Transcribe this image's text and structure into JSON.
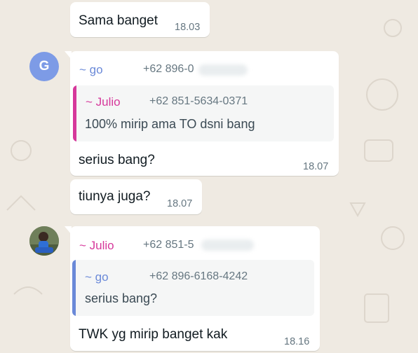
{
  "colors": {
    "background": "#efeae2",
    "bubble": "#ffffff",
    "go_name": "#6a89d8",
    "julio_name": "#d6389b",
    "go_avatar": "#7d9be6",
    "julio_bar": "#d6389b",
    "go_bar": "#6a89d8"
  },
  "messages": [
    {
      "text": "Sama banget",
      "time": "18.03"
    },
    {
      "avatar": {
        "letter": "G",
        "icon": "avatar-letter-g"
      },
      "sender": "~ go",
      "phone": "+62 896-0",
      "quote": {
        "sender": "~ Julio",
        "phone": "+62 851-5634-0371",
        "text": "100% mirip ama TO dsni bang"
      },
      "text": "serius bang?",
      "time": "18.07"
    },
    {
      "text": "tiunya juga?",
      "time": "18.07"
    },
    {
      "avatar": {
        "icon": "avatar-photo-julio"
      },
      "sender": "~ Julio",
      "phone": "+62 851-5",
      "quote": {
        "sender": "~ go",
        "phone": "+62 896-6168-4242",
        "text": "serius bang?"
      },
      "text": "TWK yg mirip banget kak",
      "time": "18.16"
    }
  ]
}
